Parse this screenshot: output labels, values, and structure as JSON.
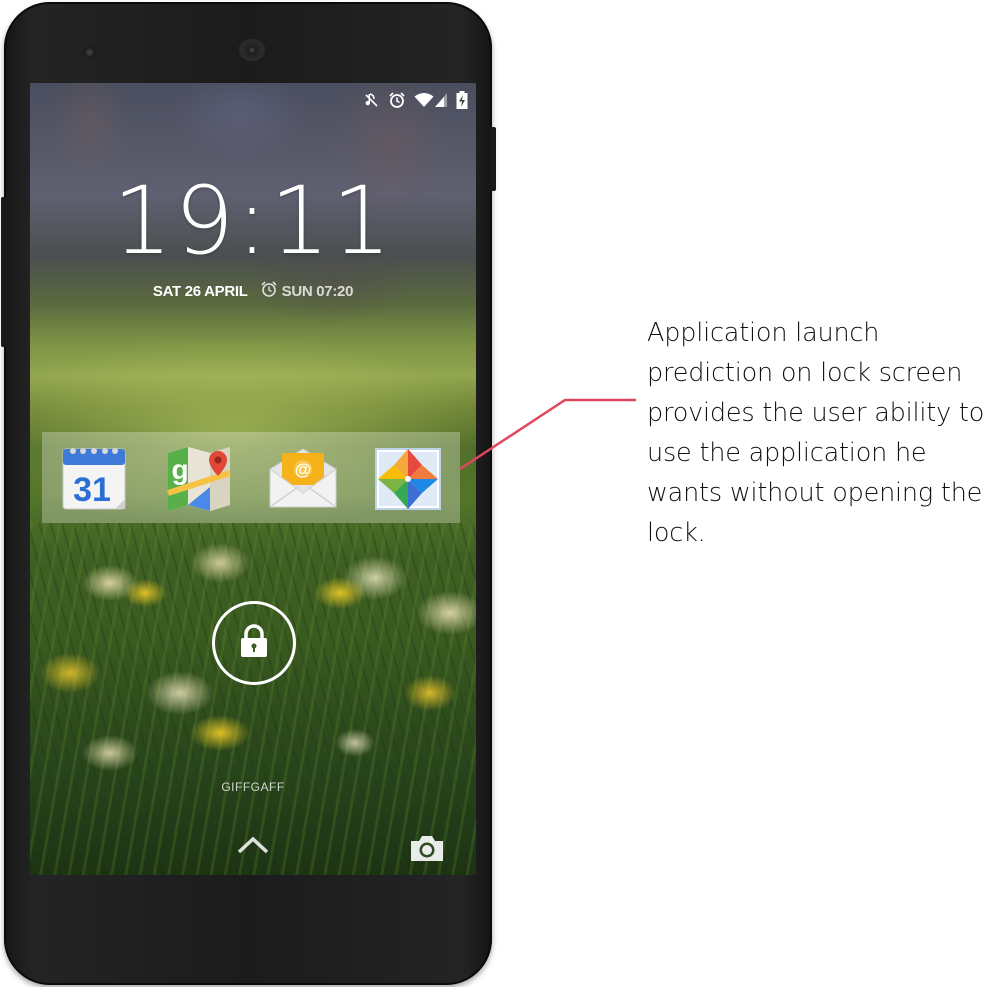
{
  "status_bar": {
    "icons": [
      "mute-icon",
      "alarm-icon",
      "wifi-icon",
      "signal-icon",
      "battery-charging-icon"
    ]
  },
  "lockscreen": {
    "time": "19:11",
    "date": "SAT 26 APRIL",
    "alarm": "SUN 07:20",
    "carrier": "GIFFGAFF"
  },
  "predicted_apps": [
    {
      "name": "calendar-app-icon",
      "label": "31"
    },
    {
      "name": "maps-app-icon",
      "label": "g"
    },
    {
      "name": "email-app-icon",
      "label": "@"
    },
    {
      "name": "photos-app-icon",
      "label": ""
    }
  ],
  "annotation": {
    "text": "Application launch prediction on lock screen provides the user ability to use the application he wants without opening the lock."
  },
  "colors": {
    "callout_line": "#e0475e",
    "annotation_text": "#111111"
  }
}
